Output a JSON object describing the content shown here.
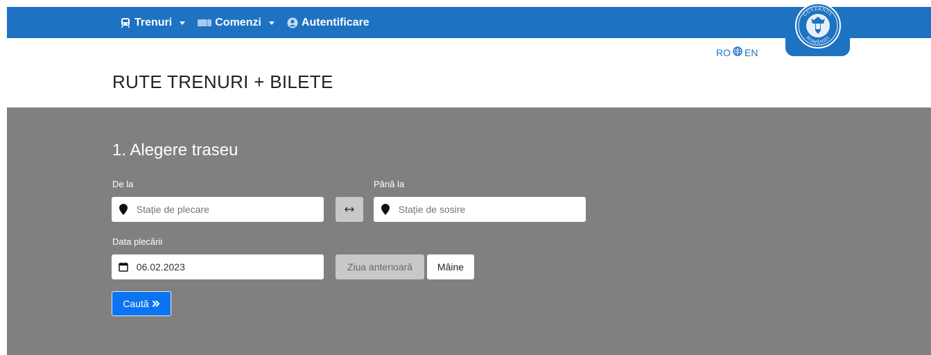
{
  "nav": {
    "items": [
      {
        "label": "Trenuri",
        "icon": "train-icon",
        "has_dropdown": true
      },
      {
        "label": "Comenzi",
        "icon": "ticket-icon",
        "has_dropdown": true
      },
      {
        "label": "Autentificare",
        "icon": "user-circle-icon",
        "has_dropdown": false
      }
    ],
    "background_color": "#1d72c2"
  },
  "emblem": {
    "text_top": "GUVERNUL",
    "text_bottom": "ROMÂNIEI"
  },
  "language": {
    "ro": "RO",
    "en": "EN",
    "icon": "globe-icon"
  },
  "page_title": "RUTE TRENURI + BILETE",
  "search": {
    "section_title": "1. Alegere traseu",
    "from_label": "De la",
    "from_placeholder": "Stație de plecare",
    "to_label": "Până la",
    "to_placeholder": "Stație de sosire",
    "date_label": "Data plecării",
    "date_value": "06.02.2023",
    "prev_day_label": "Ziua anterioară",
    "next_day_label": "Mâine",
    "search_label": "Caută",
    "section_background": "#808080",
    "search_button_color": "#0b74f0"
  }
}
